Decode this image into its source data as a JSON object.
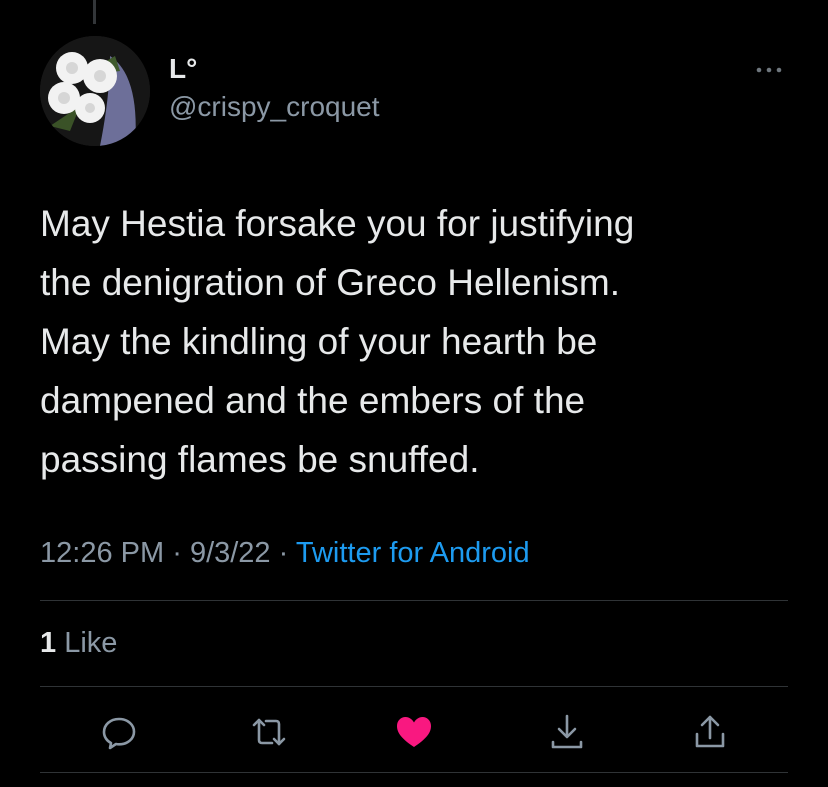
{
  "author": {
    "display_name": "L°",
    "handle": "@crispy_croquet"
  },
  "tweet": {
    "text": "May Hestia forsake you for justifying\nthe denigration of Greco Hellenism.\nMay the kindling of your hearth be\ndampened and the embers of the\npassing flames be snuffed."
  },
  "meta": {
    "time": "12:26 PM",
    "separator": "·",
    "date": "9/3/22",
    "source": "Twitter for Android"
  },
  "stats": {
    "likes_count": "1",
    "likes_label": "Like"
  },
  "actions": [
    "reply-icon",
    "retweet-icon",
    "like-icon",
    "download-icon",
    "share-icon"
  ],
  "colors": {
    "background": "#000000",
    "text": "#e7e9ea",
    "secondary": "#8b98a5",
    "link": "#1d9bf0",
    "like_active": "#f91880",
    "divider": "#2f3336"
  }
}
